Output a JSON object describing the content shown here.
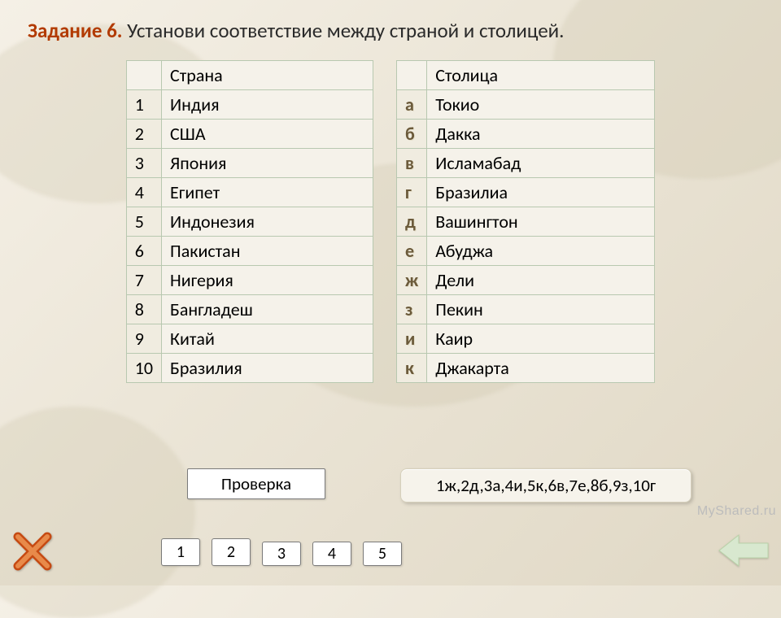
{
  "title_strong": "Задание 6.",
  "title_rest": " Установи соответствие между страной и столицей.",
  "countries": {
    "header": "Страна",
    "rows": [
      {
        "n": "1",
        "v": "Индия"
      },
      {
        "n": "2",
        "v": "США"
      },
      {
        "n": "3",
        "v": "Япония"
      },
      {
        "n": "4",
        "v": "Египет"
      },
      {
        "n": "5",
        "v": "Индонезия"
      },
      {
        "n": "6",
        "v": "Пакистан"
      },
      {
        "n": "7",
        "v": "Нигерия"
      },
      {
        "n": "8",
        "v": "Бангладеш"
      },
      {
        "n": "9",
        "v": "Китай"
      },
      {
        "n": "10",
        "v": "Бразилия"
      }
    ]
  },
  "capitals": {
    "header": "Столица",
    "rows": [
      {
        "n": "а",
        "v": "Токио"
      },
      {
        "n": "б",
        "v": "Дакка"
      },
      {
        "n": "в",
        "v": "Исламабад"
      },
      {
        "n": "г",
        "v": "Бразилиа"
      },
      {
        "n": "д",
        "v": "Вашингтон"
      },
      {
        "n": "е",
        "v": "Абуджа"
      },
      {
        "n": "ж",
        "v": "Дели"
      },
      {
        "n": "з",
        "v": "Пекин"
      },
      {
        "n": "и",
        "v": "Каир"
      },
      {
        "n": "к",
        "v": "Джакарта"
      }
    ]
  },
  "check_label": "Проверка",
  "answer_text": "1ж,2д,3а,4и,5к,6в,7е,8б,9з,10г",
  "nav": [
    "1",
    "2",
    "3",
    "4",
    "5"
  ],
  "watermark": "MyShared.ru"
}
